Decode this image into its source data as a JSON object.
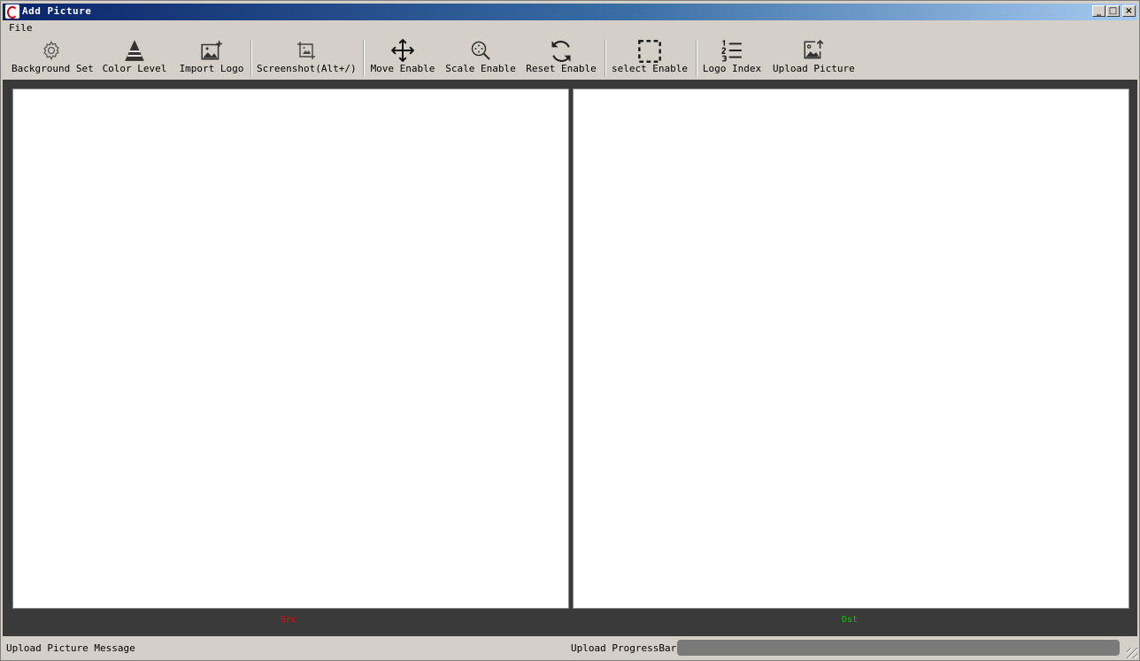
{
  "window": {
    "title": "Add Picture",
    "controls": {
      "minimize": "_",
      "maximize": "□",
      "close": "×"
    }
  },
  "menu": {
    "items": [
      "File"
    ]
  },
  "toolbar": {
    "buttons": [
      {
        "label": "Background Set",
        "icon": "gear-icon"
      },
      {
        "label": "Color Level",
        "icon": "pyramid-icon"
      },
      {
        "label": "Import Logo",
        "icon": "image-add-icon"
      },
      {
        "label": "Screenshot(Alt+/)",
        "icon": "crop-image-icon"
      },
      {
        "label": "Move Enable",
        "icon": "move-arrows-icon"
      },
      {
        "label": "Scale Enable",
        "icon": "zoom-icon"
      },
      {
        "label": "Reset Enable",
        "icon": "refresh-icon"
      },
      {
        "label": "select Enable",
        "icon": "selection-icon"
      },
      {
        "label": "Logo Index",
        "icon": "numbered-list-icon"
      },
      {
        "label": "Upload Picture",
        "icon": "image-upload-icon"
      }
    ]
  },
  "panes": {
    "src": {
      "label": "Src",
      "color": "#ff0000"
    },
    "dst": {
      "label": "Dst",
      "color": "#00cc00"
    }
  },
  "status": {
    "message": "Upload Picture Message",
    "progress_label": "Upload ProgressBar:",
    "progress_value": 0
  }
}
